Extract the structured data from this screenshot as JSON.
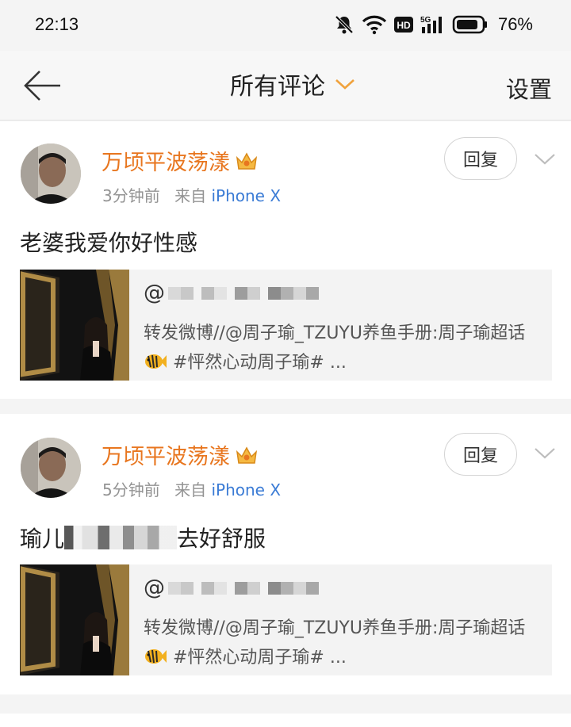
{
  "status_bar": {
    "time": "22:13",
    "battery_percent": "76%",
    "hd_label": "HD",
    "network_label": "5G"
  },
  "nav": {
    "title": "所有评论",
    "settings_label": "设置"
  },
  "comments": [
    {
      "username": "万顷平波荡漾",
      "time": "3分钟前",
      "from_label": "来自",
      "device": "iPhone X",
      "reply_label": "回复",
      "text": "老婆我爱你好性感",
      "repost": {
        "user_prefix": "@",
        "user_visible": "",
        "body_text": "转发微博//@周子瑜_TZUYU养鱼手册:周子瑜超话",
        "hashtag_text": "#怦然心动周子瑜# ..."
      }
    },
    {
      "username": "万顷平波荡漾",
      "time": "5分钟前",
      "from_label": "来自",
      "device": "iPhone X",
      "reply_label": "回复",
      "text_start": "瑜儿",
      "text_end": "去好舒服",
      "repost": {
        "user_prefix": "@",
        "user_visible": "",
        "body_text": "转发微博//@周子瑜_TZUYU养鱼手册:周子瑜超话",
        "hashtag_text": "#怦然心动周子瑜# ..."
      }
    }
  ],
  "colors": {
    "username": "#e8761f",
    "device_link": "#3a7bd5",
    "chevron_accent": "#f0a23c"
  }
}
